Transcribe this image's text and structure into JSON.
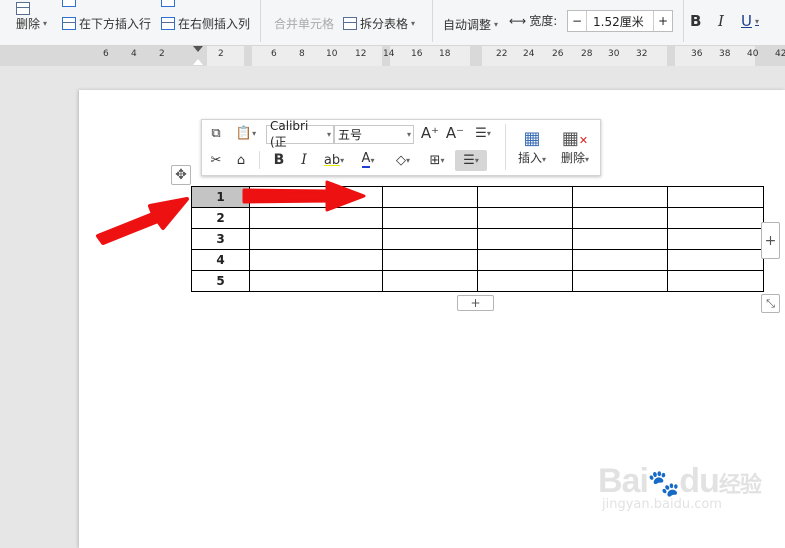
{
  "ribbon": {
    "delete_label": "删除",
    "insert_below_label": "在下方插入行",
    "insert_right_label": "在右侧插入列",
    "merge_cells_label": "合并单元格",
    "split_table_label": "拆分表格",
    "auto_adjust_label": "自动调整",
    "width_label": "宽度:",
    "width_value": "1.52厘米",
    "bold_label": "B",
    "italic_label": "I",
    "underline_label": "U"
  },
  "ruler": {
    "ticks": [
      "6",
      "4",
      "2",
      "2",
      "6",
      "8",
      "10",
      "12",
      "14",
      "16",
      "18",
      "22",
      "24",
      "26",
      "28",
      "30",
      "32",
      "36",
      "38",
      "40",
      "42"
    ]
  },
  "float_toolbar": {
    "font_name": "Calibri (正",
    "font_size": "五号",
    "bold": "B",
    "italic": "I",
    "insert_label": "插入",
    "delete_label": "删除"
  },
  "table": {
    "row_numbers": [
      "1",
      "2",
      "3",
      "4",
      "5"
    ],
    "columns": 6
  },
  "arrows": {
    "color": "#ee1111"
  },
  "watermark": {
    "text": "Bai",
    "text2": "du",
    "cn": "经验",
    "url": "jingyan.baidu.com"
  }
}
